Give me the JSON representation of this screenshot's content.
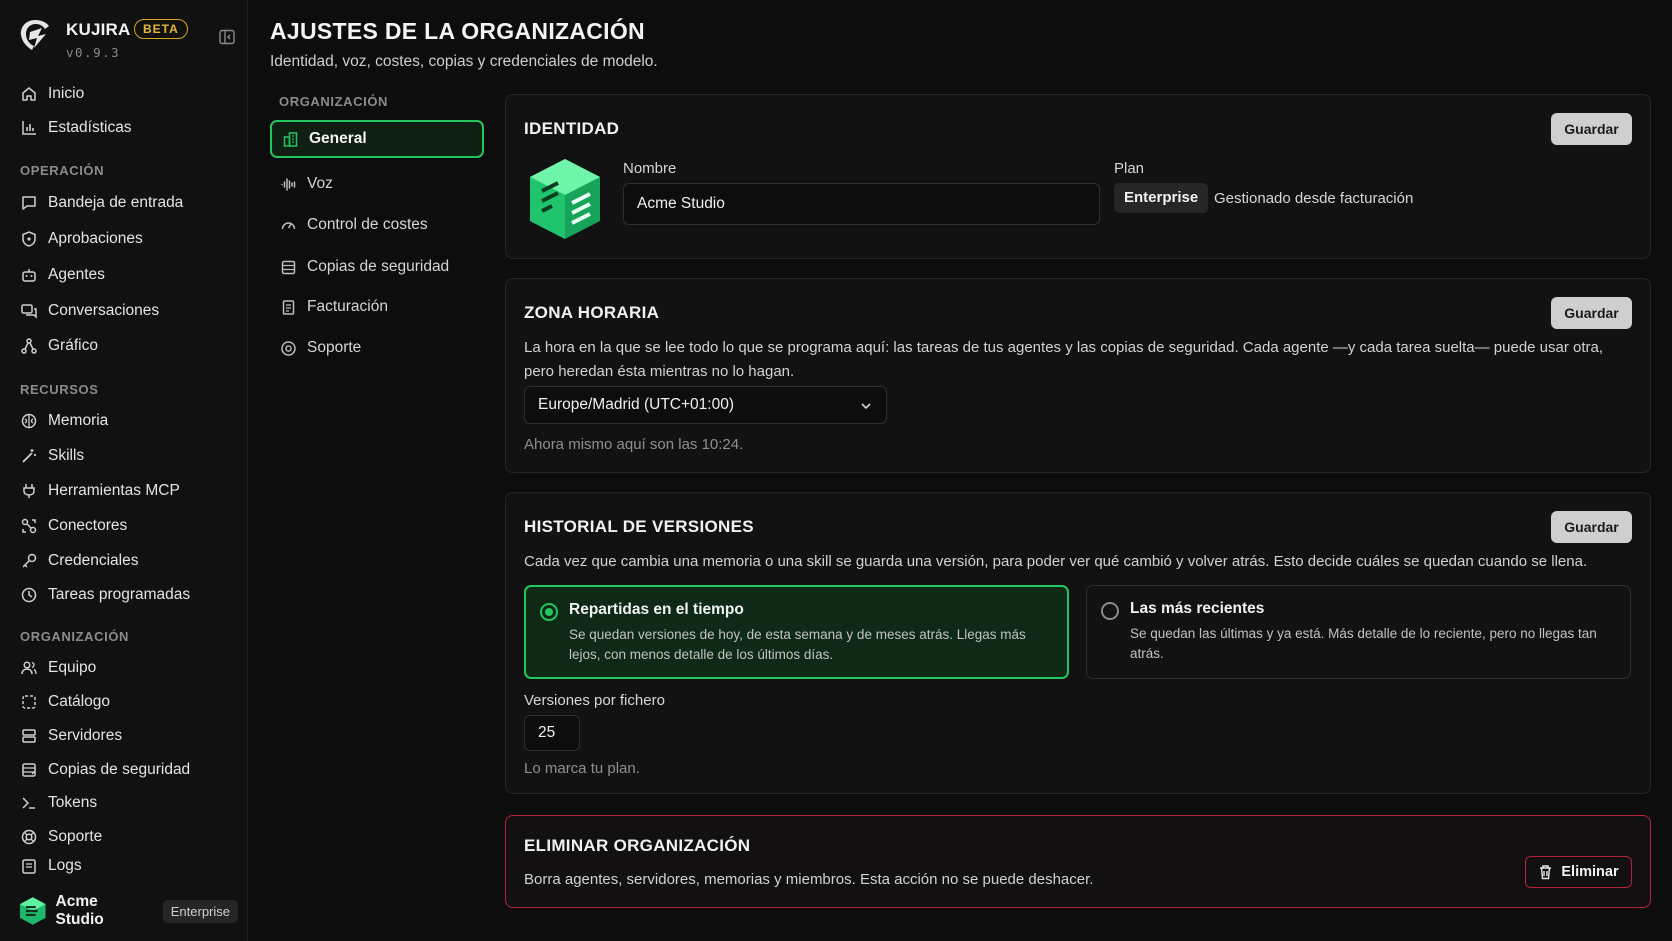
{
  "brand": {
    "name": "KUJIRA",
    "badge": "BETA",
    "version": "v0.9.3"
  },
  "sidebar": {
    "top_items": [
      {
        "label": "Inicio",
        "icon": "home-icon"
      },
      {
        "label": "Estadísticas",
        "icon": "bar-chart-icon"
      }
    ],
    "sections": [
      {
        "title": "OPERACIÓN",
        "items": [
          {
            "label": "Bandeja de entrada",
            "icon": "inbox-icon"
          },
          {
            "label": "Aprobaciones",
            "icon": "shield-icon"
          },
          {
            "label": "Agentes",
            "icon": "bot-icon"
          },
          {
            "label": "Conversaciones",
            "icon": "chat-icon"
          },
          {
            "label": "Gráfico",
            "icon": "graph-icon"
          }
        ]
      },
      {
        "title": "RECURSOS",
        "items": [
          {
            "label": "Memoria",
            "icon": "brain-icon"
          },
          {
            "label": "Skills",
            "icon": "wand-icon"
          },
          {
            "label": "Herramientas MCP",
            "icon": "plug-icon"
          },
          {
            "label": "Conectores",
            "icon": "connector-icon"
          },
          {
            "label": "Credenciales",
            "icon": "key-icon"
          },
          {
            "label": "Tareas programadas",
            "icon": "clock-icon"
          }
        ]
      },
      {
        "title": "ORGANIZACIÓN",
        "items": [
          {
            "label": "Equipo",
            "icon": "users-icon"
          },
          {
            "label": "Catálogo",
            "icon": "catalog-icon"
          },
          {
            "label": "Servidores",
            "icon": "server-icon"
          },
          {
            "label": "Copias de seguridad",
            "icon": "backup-icon"
          },
          {
            "label": "Tokens",
            "icon": "terminal-icon"
          },
          {
            "label": "Soporte",
            "icon": "lifebuoy-icon"
          },
          {
            "label": "Logs",
            "icon": "logs-icon"
          }
        ]
      }
    ],
    "footer": {
      "org_name": "Acme Studio",
      "plan": "Enterprise"
    }
  },
  "header": {
    "title": "AJUSTES DE LA ORGANIZACIÓN",
    "subtitle": "Identidad, voz, costes, copias y credenciales de modelo."
  },
  "subnav": {
    "section": "ORGANIZACIÓN",
    "items": [
      {
        "label": "General",
        "icon": "building-icon",
        "active": true
      },
      {
        "label": "Voz",
        "icon": "waveform-icon",
        "active": false
      },
      {
        "label": "Control de costes",
        "icon": "gauge-icon",
        "active": false
      },
      {
        "label": "Copias de seguridad",
        "icon": "backup-icon",
        "active": false
      },
      {
        "label": "Facturación",
        "icon": "receipt-icon",
        "active": false
      },
      {
        "label": "Soporte",
        "icon": "lifebuoy-icon",
        "active": false
      }
    ]
  },
  "identity": {
    "title": "IDENTIDAD",
    "save_label": "Guardar",
    "name_label": "Nombre",
    "name_value": "Acme Studio",
    "plan_label": "Plan",
    "plan_value": "Enterprise",
    "plan_note": "Gestionado desde facturación"
  },
  "timezone": {
    "title": "ZONA HORARIA",
    "save_label": "Guardar",
    "description": "La hora en la que se lee todo lo que se programa aquí: las tareas de tus agentes y las copias de seguridad. Cada agente —y cada tarea suelta— puede usar otra, pero heredan ésta mientras no lo hagan.",
    "selected": "Europe/Madrid (UTC+01:00)",
    "now_text": "Ahora mismo aquí son las 10:24."
  },
  "versions": {
    "title": "HISTORIAL DE VERSIONES",
    "save_label": "Guardar",
    "description": "Cada vez que cambia una memoria o una skill se guarda una versión, para poder ver qué cambió y volver atrás. Esto decide cuáles se quedan cuando se llena.",
    "options": [
      {
        "title": "Repartidas en el tiempo",
        "desc": "Se quedan versiones de hoy, de esta semana y de meses atrás. Llegas más lejos, con menos detalle de los últimos días.",
        "selected": true
      },
      {
        "title": "Las más recientes",
        "desc": "Se quedan las últimas y ya está. Más detalle de lo reciente, pero no llegas tan atrás.",
        "selected": false
      }
    ],
    "per_file_label": "Versiones por fichero",
    "per_file_value": "25",
    "per_file_note": "Lo marca tu plan."
  },
  "delete_org": {
    "title": "ELIMINAR ORGANIZACIÓN",
    "description": "Borra agentes, servidores, memorias y miembros. Esta acción no se puede deshacer.",
    "button_label": "Eliminar"
  },
  "colors": {
    "accent": "#22c55e",
    "danger": "#b3243a",
    "beta": "#d9a521"
  }
}
